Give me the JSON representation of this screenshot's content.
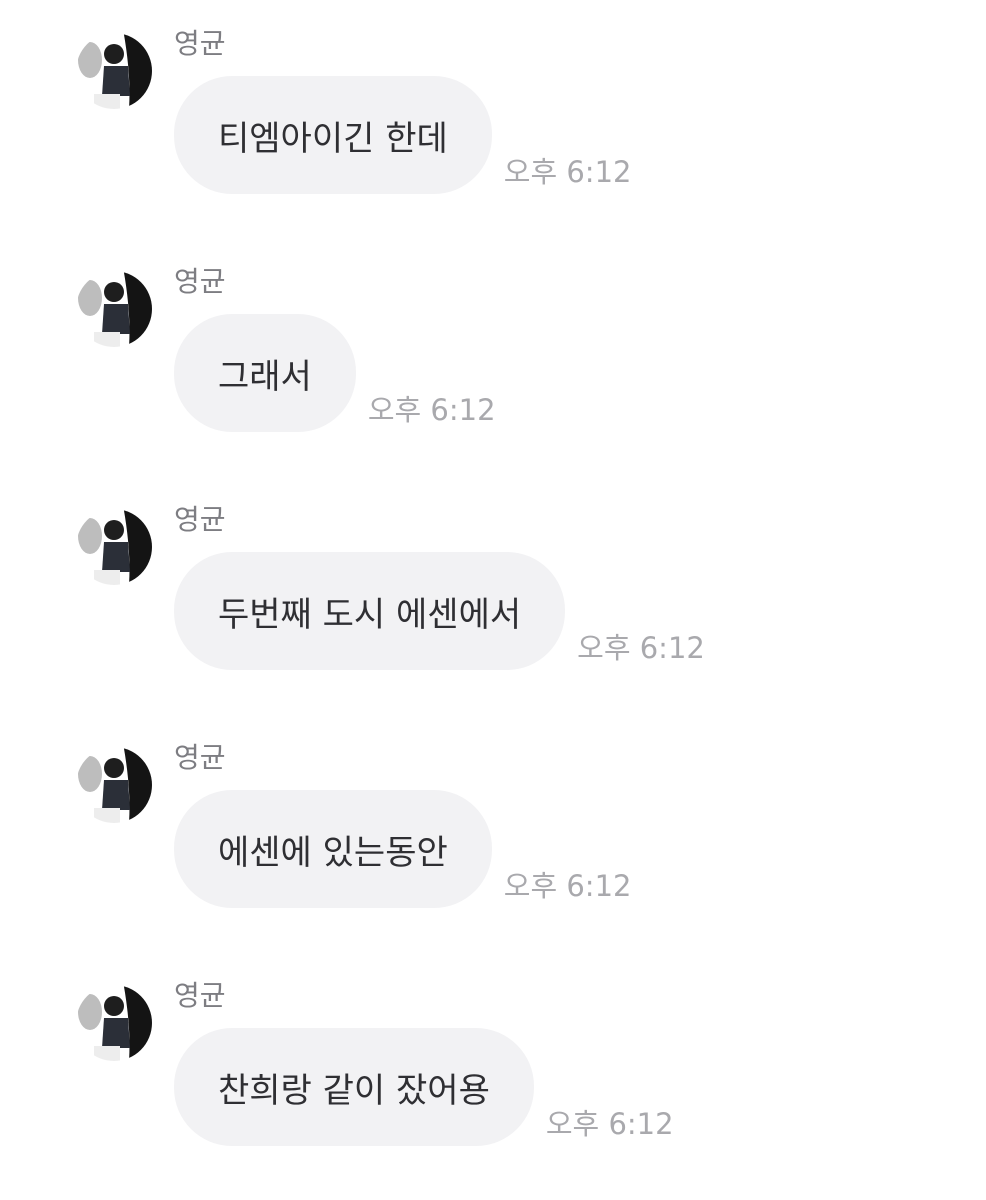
{
  "messages": [
    {
      "sender": "영균",
      "text": "티엠아이긴 한데",
      "time": "오후 6:12"
    },
    {
      "sender": "영균",
      "text": "그래서",
      "time": "오후 6:12"
    },
    {
      "sender": "영균",
      "text": "두번째 도시 에센에서",
      "time": "오후 6:12"
    },
    {
      "sender": "영균",
      "text": "에센에 있는동안",
      "time": "오후 6:12"
    },
    {
      "sender": "영균",
      "text": "찬희랑 같이 잤어용",
      "time": "오후 6:12"
    }
  ],
  "colors": {
    "bubble": "#f2f2f4",
    "message_text": "#2f2f33",
    "sender_text": "#7d7d82",
    "time_text": "#a9a9ad"
  },
  "icons": {
    "avatar": "profile-photo-avatar"
  }
}
